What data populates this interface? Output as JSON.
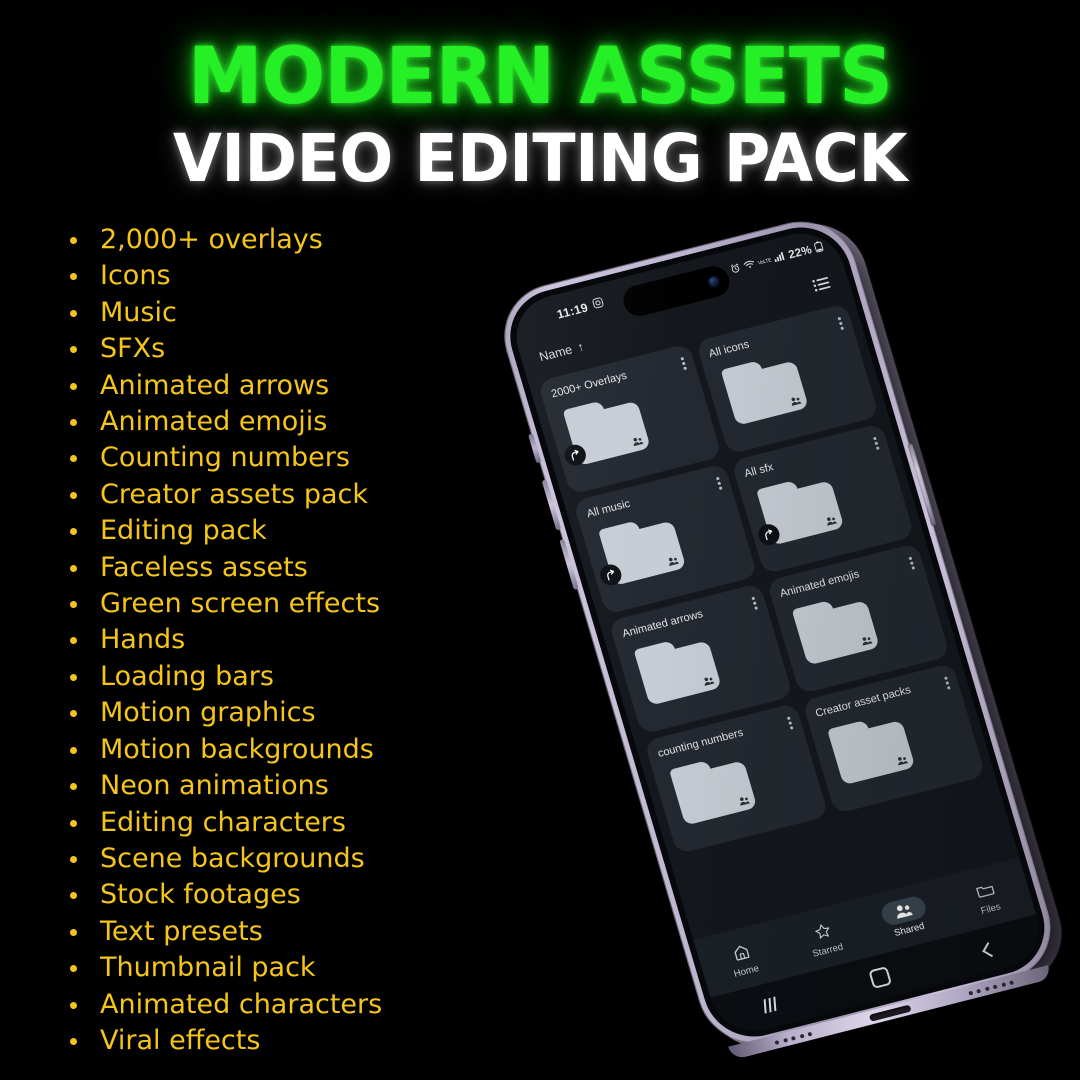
{
  "headline": {
    "line1": "MODERN ASSETS",
    "line2": "VIDEO EDITING PACK",
    "line1_color": "#25ef25",
    "line2_color": "#ffffff"
  },
  "features": {
    "bullet_color": "#f5c518",
    "items": [
      "2,000+ overlays",
      "Icons",
      "Music",
      "SFXs",
      "Animated arrows",
      "Animated emojis",
      "Counting numbers",
      "Creator assets pack",
      "Editing pack",
      "Faceless assets",
      "Green screen effects",
      "Hands",
      "Loading bars",
      "Motion graphics",
      "Motion backgrounds",
      "Neon animations",
      "Editing characters",
      "Scene backgrounds",
      "Stock footages",
      "Text presets",
      "Thumbnail pack",
      "Animated characters",
      "Viral effects"
    ]
  },
  "phone": {
    "frame_color": "#bdb5ce",
    "screen_bg": "#14181d",
    "card_bg": "#242931",
    "folder_color": "#c8cdd5",
    "statusbar": {
      "time": "11:19",
      "icons_left": [
        "screen-record-icon"
      ],
      "icons_right": [
        "alarm-icon",
        "wifi-icon",
        "volte-icon",
        "signal-icon"
      ],
      "volte_label": "VoLTE",
      "battery_percent": "22%"
    },
    "app_header": {
      "sort_label": "Name",
      "sort_arrow": "↑",
      "view_toggle": "list-view-icon"
    },
    "folders": [
      {
        "name": "2000+ Overlays",
        "shared": true,
        "shortcut": true
      },
      {
        "name": "All icons",
        "shared": true,
        "shortcut": false
      },
      {
        "name": "All music",
        "shared": true,
        "shortcut": true
      },
      {
        "name": "All sfx",
        "shared": true,
        "shortcut": true
      },
      {
        "name": "Animated arrows",
        "shared": true,
        "shortcut": false
      },
      {
        "name": "Animated emojis",
        "shared": true,
        "shortcut": false
      },
      {
        "name": "counting numbers",
        "shared": true,
        "shortcut": false
      },
      {
        "name": "Creator asset packs",
        "shared": true,
        "shortcut": false
      }
    ],
    "bottom_nav": {
      "active": "Shared",
      "items": [
        {
          "label": "Home",
          "icon": "home-icon"
        },
        {
          "label": "Starred",
          "icon": "star-icon"
        },
        {
          "label": "Shared",
          "icon": "people-icon"
        },
        {
          "label": "Files",
          "icon": "folder-icon"
        }
      ]
    },
    "android_nav": {
      "recents": "recents-icon",
      "home": "home-square-icon",
      "back": "back-chevron-icon"
    }
  }
}
